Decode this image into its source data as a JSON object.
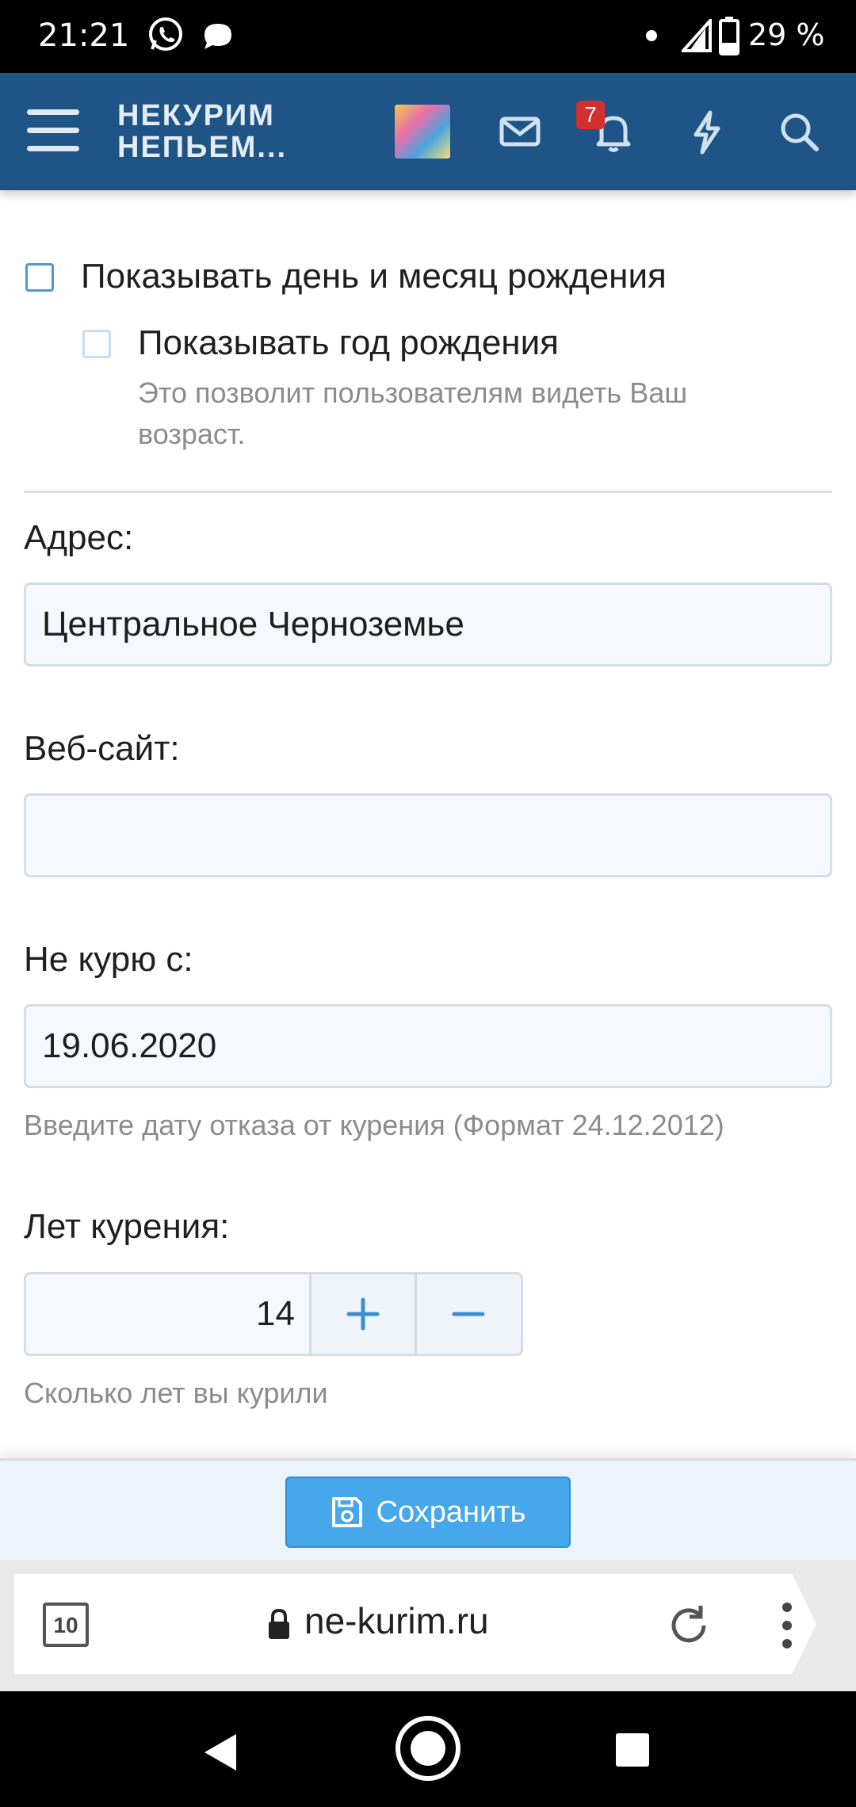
{
  "status_bar": {
    "time": "21:21",
    "battery_text": "29 %",
    "icons": [
      "whatsapp-icon",
      "message-icon",
      "dot-icon",
      "signal-icon",
      "battery-icon"
    ]
  },
  "header": {
    "logo_line1": "НЕКУРИМ",
    "logo_line2": "НЕПЬЕМ...",
    "notification_count": "7",
    "icons": [
      "menu-icon",
      "avatar",
      "mail-icon",
      "bell-icon",
      "lightning-icon",
      "search-icon"
    ],
    "color": "#1e5486"
  },
  "form": {
    "show_birthday_label": "Показывать день и месяц рождения",
    "show_year_label": "Показывать год рождения",
    "show_year_hint": "Это позволит пользователям видеть Ваш возраст.",
    "address_label": "Адрес:",
    "address_value": "Центральное Черноземье",
    "website_label": "Веб-сайт:",
    "website_value": "",
    "quit_date_label": "Не курю с:",
    "quit_date_value": "19.06.2020",
    "quit_date_hint": "Введите дату отказа от курения (Формат 24.12.2012)",
    "years_label": "Лет курения:",
    "years_value": "14",
    "years_plus": "+",
    "years_minus": "−",
    "years_hint": "Сколько лет вы курили"
  },
  "save_bar": {
    "save_label": "Сохранить",
    "accent": "#47a7eb"
  },
  "browser": {
    "tab_count": "10",
    "url": "ne-kurim.ru"
  }
}
